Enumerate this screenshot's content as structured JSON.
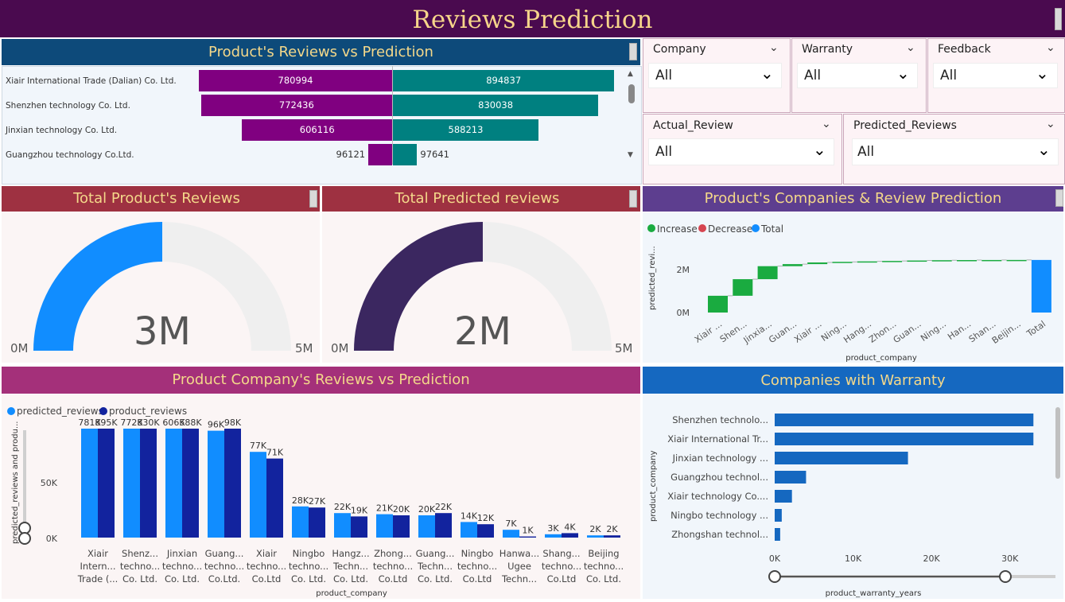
{
  "title": "Reviews Prediction",
  "panel1": {
    "title": "Product's Reviews vs Prediction",
    "rows": [
      {
        "company": "Xiair International Trade (Dalian) Co. Ltd.",
        "actual": 780994,
        "predicted": 894837
      },
      {
        "company": "Shenzhen technology Co. Ltd.",
        "actual": 772436,
        "predicted": 830038
      },
      {
        "company": "Jinxian technology Co. Ltd.",
        "actual": 606116,
        "predicted": 588213
      },
      {
        "company": "Guangzhou technology Co.Ltd.",
        "actual": 96121,
        "predicted": 97641
      }
    ]
  },
  "slicers": {
    "company": {
      "label": "Company",
      "value": "All"
    },
    "warranty": {
      "label": "Warranty",
      "value": "All"
    },
    "feedback": {
      "label": "Feedback",
      "value": "All"
    },
    "actual_review": {
      "label": "Actual_Review",
      "value": "All"
    },
    "predicted_reviews": {
      "label": "Predicted_Reviews",
      "value": "All"
    }
  },
  "gauge1": {
    "title": "Total Product's Reviews",
    "value_label": "3M",
    "min": "0M",
    "max": "5M",
    "fraction": 0.5
  },
  "gauge2": {
    "title": "Total Predicted reviews",
    "value_label": "2M",
    "min": "0M",
    "max": "5M",
    "fraction": 0.5
  },
  "waterfall": {
    "title": "Product's Companies & Review Prediction",
    "legend": [
      "Increase",
      "Decrease",
      "Total"
    ],
    "colors": {
      "increase": "#1aab40",
      "decrease": "#d64550",
      "total": "#118dff"
    },
    "ylabel": "predicted_revi...",
    "xlabel": "product_company",
    "yticks": [
      "2M",
      "0M"
    ],
    "categories": [
      "Xiair ...",
      "Shen...",
      "Jinxia...",
      "Guan...",
      "Xiair ...",
      "Ning...",
      "Hang...",
      "Zhon...",
      "Guan...",
      "Ning...",
      "Han...",
      "Shan...",
      "Beijin...",
      "Total"
    ]
  },
  "chart_data": [
    {
      "type": "bar",
      "title": "Product Company's Reviews vs Prediction",
      "xlabel": "product_company",
      "ylabel": "predicted_reviews and produ...",
      "yticks": [
        "50K",
        "0K"
      ],
      "ylim": [
        0,
        100000
      ],
      "categories": [
        [
          "Xiair",
          "Intern...",
          "Trade (..."
        ],
        [
          "Shenz...",
          "techno...",
          "Co. Ltd."
        ],
        [
          "Jinxian",
          "techno...",
          "Co. Ltd."
        ],
        [
          "Guang...",
          "techno...",
          "Co.Ltd."
        ],
        [
          "Xiair",
          "techno...",
          "Co.Ltd"
        ],
        [
          "Ningbo",
          "techno...",
          "Co. Ltd."
        ],
        [
          "Hangz...",
          "Techn...",
          "Co. Ltd."
        ],
        [
          "Zhong...",
          "techno...",
          "Co.Ltd"
        ],
        [
          "Guang...",
          "Techn...",
          "Co. Ltd."
        ],
        [
          "Ningbo",
          "techno...",
          "Co.Ltd"
        ],
        [
          "Hanwa...",
          "Ugee",
          "Techn..."
        ],
        [
          "Shang...",
          "techno...",
          "Co.Ltd"
        ],
        [
          "Beijing",
          "techno...",
          "Co. Ltd."
        ]
      ],
      "series": [
        {
          "name": "predicted_reviews",
          "color": "#118dff",
          "values": [
            781000,
            772000,
            606000,
            96000,
            77000,
            28000,
            22000,
            21000,
            20000,
            14000,
            7000,
            3000,
            2000
          ],
          "labels": [
            "781K",
            "772K",
            "606K",
            "96K",
            "77K",
            "28K",
            "22K",
            "21K",
            "20K",
            "14K",
            "7K",
            "3K",
            "2K"
          ]
        },
        {
          "name": "product_reviews",
          "color": "#12239e",
          "values": [
            895000,
            830000,
            588000,
            98000,
            71000,
            27000,
            19000,
            20000,
            22000,
            12000,
            1000,
            4000,
            2000
          ],
          "labels": [
            "895K",
            "830K",
            "588K",
            "98K",
            "71K",
            "27K",
            "19K",
            "20K",
            "22K",
            "12K",
            "1K",
            "4K",
            "2K"
          ]
        }
      ]
    },
    {
      "type": "bar",
      "orientation": "horizontal",
      "title": "Companies with Warranty",
      "xlabel": "product_warranty_years",
      "ylabel": "product_company",
      "xticks": [
        "0K",
        "10K",
        "20K",
        "30K"
      ],
      "xlim": [
        0,
        35000
      ],
      "categories": [
        "Shenzhen technolo...",
        "Xiair International Tr...",
        "Jinxian technology ...",
        "Guangzhou technol...",
        "Xiair technology Co....",
        "Ningbo technology ...",
        "Zhongshan technol..."
      ],
      "values": [
        33000,
        33000,
        17000,
        4000,
        2200,
        900,
        700
      ],
      "color": "#1568c0"
    }
  ]
}
